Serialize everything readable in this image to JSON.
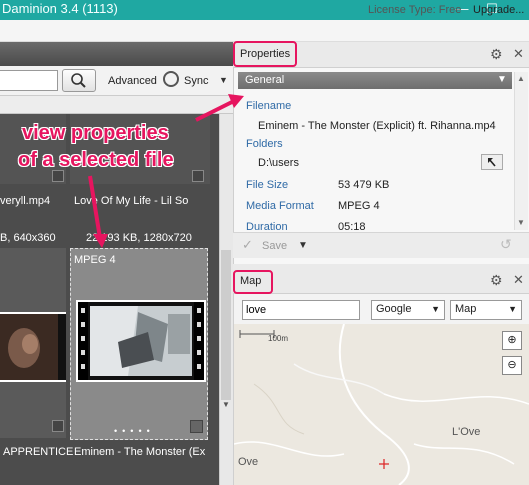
{
  "window": {
    "title": "Daminion 3.4 (1113)",
    "minimize": "—",
    "maximize": "☐"
  },
  "license": {
    "text": "License Type: Free",
    "upgrade": "Upgrade..."
  },
  "browse": {
    "search_value": "",
    "advanced_label": "Advanced",
    "sync_label": "Sync",
    "top_row": [
      {
        "name": "veryll.mp4",
        "meta": "B, 640x360"
      },
      {
        "name": "Love Of My Life - Lil So",
        "meta": "22 193 KB, 1280x720"
      }
    ],
    "selected_format": "MPEG 4",
    "bottom_row": [
      {
        "name": "APPRENTICE"
      },
      {
        "name": "Eminem - The Monster (Ex"
      }
    ]
  },
  "properties": {
    "title": "Properties",
    "group": "General",
    "fields": [
      {
        "label": "Filename",
        "value": "Eminem - The Monster (Explicit) ft. Rihanna.mp4"
      },
      {
        "label": "Folders",
        "value": "D:\\users"
      },
      {
        "label": "File Size",
        "value": "53 479 KB"
      },
      {
        "label": "Media Format",
        "value": "MPEG 4"
      },
      {
        "label": "Duration",
        "value": "05:18"
      }
    ],
    "save_label": "Save"
  },
  "map": {
    "title": "Map",
    "search_value": "love",
    "provider": "Google",
    "view": "Map",
    "scale": "100m",
    "places": [
      "L'Ove",
      "Ove"
    ]
  },
  "annotation": {
    "line1": "view properties",
    "line2": "of a selected file",
    "color": "#e6155f"
  }
}
